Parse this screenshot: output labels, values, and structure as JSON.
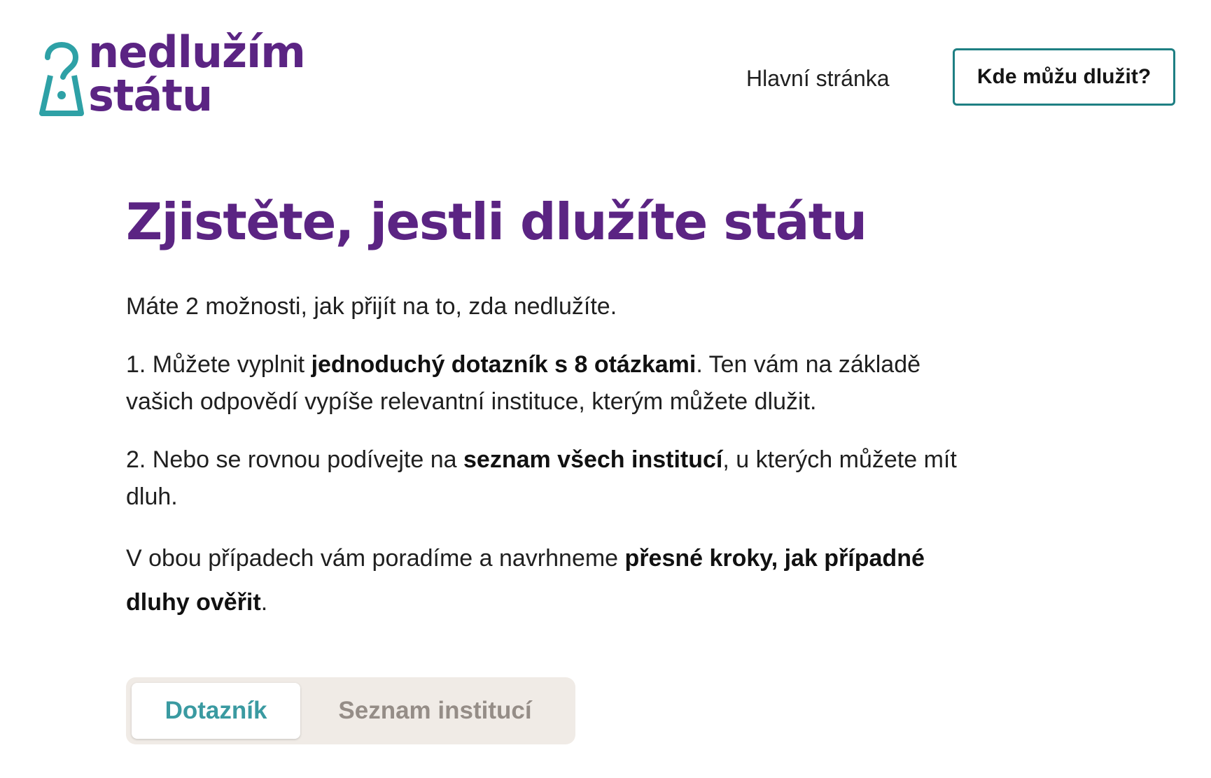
{
  "header": {
    "logo": {
      "line1": "nedlužím",
      "line2": "státu",
      "icon": "keyhole-question-icon",
      "icon_color": "#2ea1a6"
    },
    "nav_home_label": "Hlavní stránka",
    "cta_label": "Kde můžu dlužit?"
  },
  "main": {
    "title": "Zjistěte, jestli dlužíte státu",
    "intro": "Máte 2 možnosti, jak přijít na to, zda nedlužíte.",
    "option1": {
      "prefix": "1. Můžete vyplnit ",
      "bold": "jednoduchý dotazník s 8 otázkami",
      "suffix": ". Ten vám na základě vašich odpovědí vypíše relevantní instituce, kterým můžete dlužit."
    },
    "option2": {
      "prefix": "2. Nebo se rovnou podívejte na ",
      "bold": "seznam všech institucí",
      "suffix": ", u kterých můžete mít dluh."
    },
    "closing": {
      "prefix": "V obou případech vám poradíme a navrhneme ",
      "bold": "přesné kroky, jak případné dluhy ověřit",
      "suffix": "."
    }
  },
  "tabs": {
    "items": [
      {
        "label": "Dotazník",
        "active": true
      },
      {
        "label": "Seznam institucí",
        "active": false
      }
    ]
  },
  "colors": {
    "brand_purple": "#5b2483",
    "brand_teal": "#2ea1a6",
    "cta_border": "#1e7f83",
    "tab_track": "#f0ebe6",
    "tab_inactive_text": "#958d87"
  }
}
